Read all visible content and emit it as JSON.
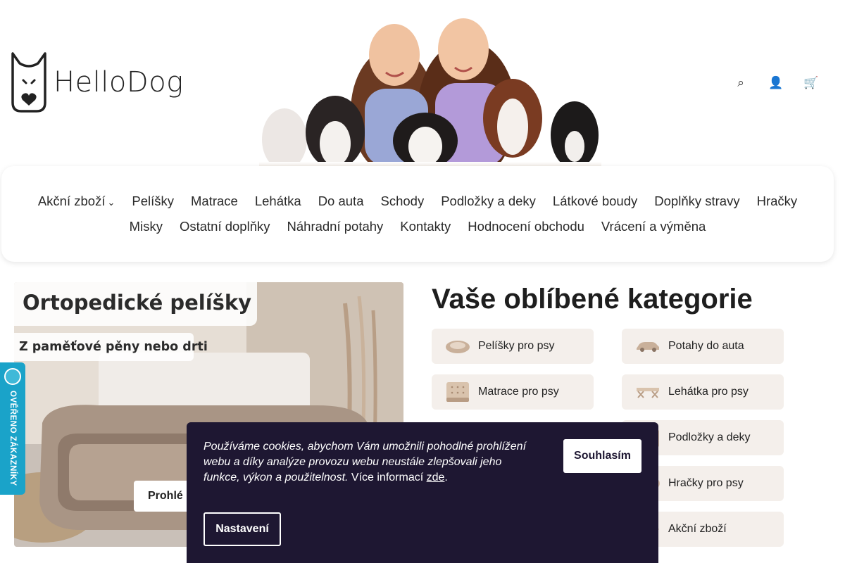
{
  "brand": {
    "name": "HelloDog"
  },
  "header": {
    "icons": [
      "search-icon",
      "user-icon",
      "cart-icon"
    ],
    "icon_glyphs": [
      "⌕",
      "👤",
      "🛒"
    ]
  },
  "nav": {
    "row1": [
      {
        "label": "Akční zboží",
        "has_dropdown": true
      },
      {
        "label": "Pelíšky"
      },
      {
        "label": "Matrace"
      },
      {
        "label": "Lehátka"
      },
      {
        "label": "Do auta"
      },
      {
        "label": "Schody"
      },
      {
        "label": "Podložky a deky"
      },
      {
        "label": "Látkové boudy"
      },
      {
        "label": "Doplňky stravy"
      },
      {
        "label": "Hračky"
      }
    ],
    "row2": [
      {
        "label": "Misky"
      },
      {
        "label": "Ostatní doplňky"
      },
      {
        "label": "Náhradní potahy"
      },
      {
        "label": "Kontakty"
      },
      {
        "label": "Hodnocení obchodu"
      },
      {
        "label": "Vrácení a výměna"
      }
    ],
    "dropdown_glyph": "⌄"
  },
  "banner": {
    "title": "Ortopedické pelíšky",
    "subtitle": "Z paměťové pěny nebo drti",
    "button_label": "Prohlé"
  },
  "verified_badge": {
    "label": "OVĚŘENO ZÁKAZNÍKY"
  },
  "categories": {
    "heading": "Vaše oblíbené kategorie",
    "items": [
      {
        "label": "Pelíšky pro psy",
        "icon": "dog-bed-icon"
      },
      {
        "label": "Potahy do auta",
        "icon": "car-icon"
      },
      {
        "label": "Matrace pro psy",
        "icon": "mattress-icon"
      },
      {
        "label": "Lehátka pro psy",
        "icon": "cot-icon"
      },
      {
        "label": "Podložky a deky",
        "icon": "blanket-icon"
      },
      {
        "label": "Hračky pro psy",
        "icon": "toy-icon"
      },
      {
        "label": "Akční zboží",
        "icon": "sale-icon"
      }
    ]
  },
  "cookie": {
    "text_italic": "Používáme cookies, abychom Vám umožnili pohodlné prohlížení webu a díky analýze provozu webu neustále zlepšovali jeho funkce, výkon a použitelnost.",
    "text_more": " Více informací ",
    "link": "zde",
    "period": ".",
    "agree_label": "Souhlasím",
    "settings_label": "Nastavení"
  },
  "colors": {
    "accent_dark": "#1e1732",
    "card_bg": "#f4efeb",
    "badge_blue": "#1aa3c9"
  }
}
